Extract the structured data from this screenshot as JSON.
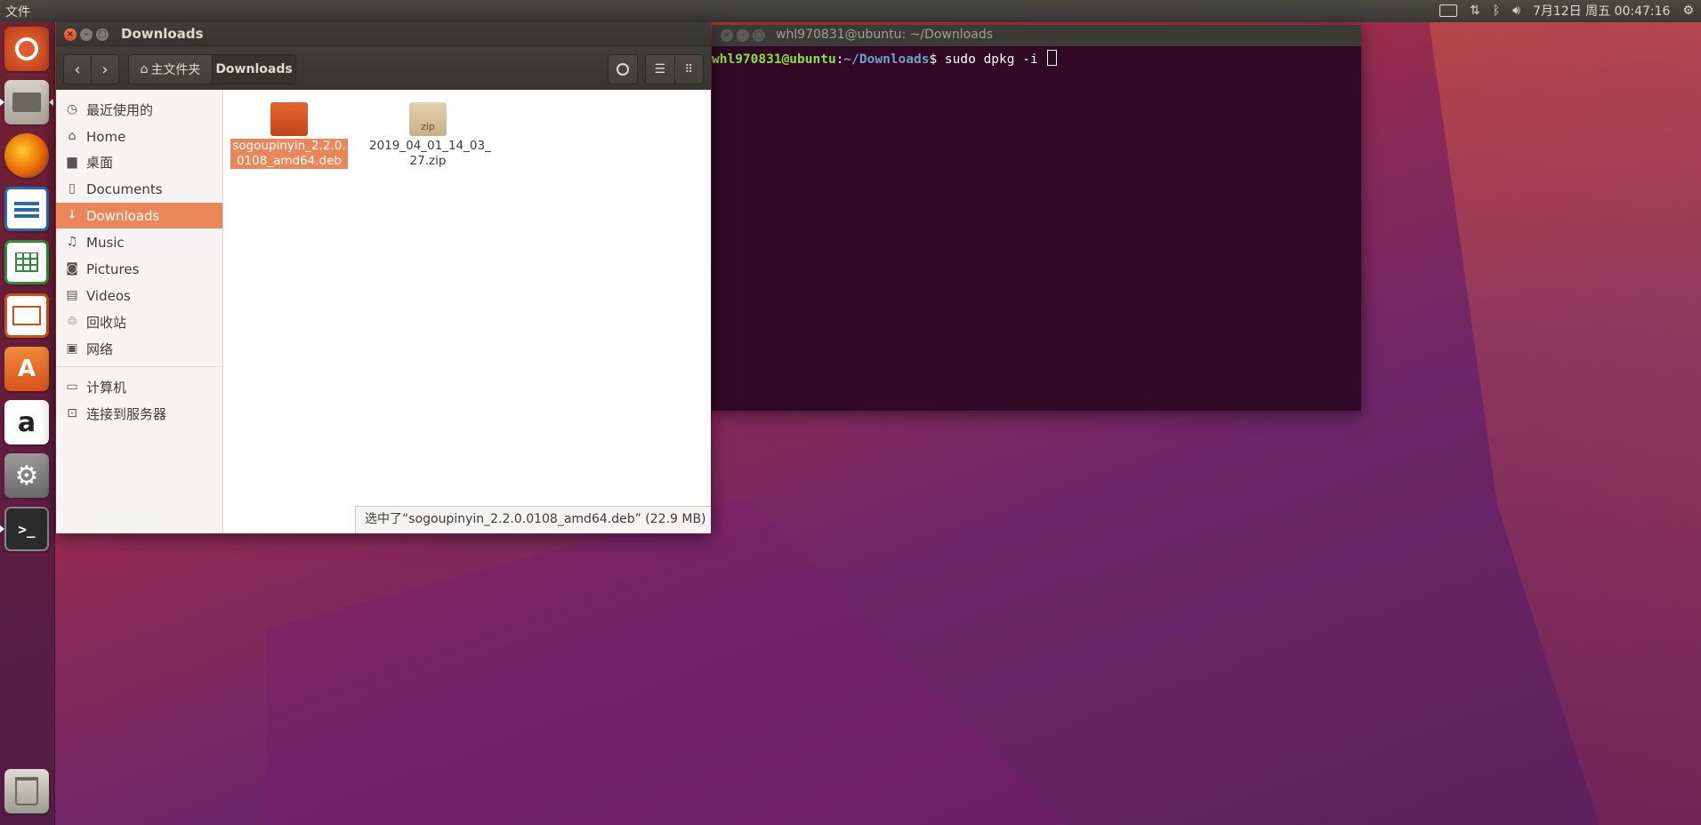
{
  "topbar": {
    "app_menu": "文件",
    "datetime": "7月12日 周五 00:47:16",
    "indicators": [
      "keyboard-icon",
      "network-icon",
      "bluetooth-icon",
      "volume-icon",
      "settings-gear-icon"
    ]
  },
  "launcher": {
    "items": [
      {
        "name": "ubuntu-dash-icon",
        "color": "#e05a2c"
      },
      {
        "name": "files-icon",
        "color": "#b9b4aa"
      },
      {
        "name": "firefox-icon",
        "color": "#e66000"
      },
      {
        "name": "writer-icon",
        "color": "#2a6aa8"
      },
      {
        "name": "calc-icon",
        "color": "#2f8b3a"
      },
      {
        "name": "impress-icon",
        "color": "#c5541d"
      },
      {
        "name": "software-center-icon",
        "color": "#e8661e"
      },
      {
        "name": "amazon-icon",
        "color": "#ffffff"
      },
      {
        "name": "system-settings-icon",
        "color": "#8c8c8c"
      },
      {
        "name": "terminal-icon",
        "color": "#2b2b2b"
      }
    ],
    "trash_icon": "trash-icon"
  },
  "file_manager": {
    "title": "Downloads",
    "breadcrumb_home": "主文件夹",
    "breadcrumb_current": "Downloads",
    "sidebar": [
      {
        "label": "最近使用的",
        "icon": "clock-icon"
      },
      {
        "label": "Home",
        "icon": "home-icon"
      },
      {
        "label": "桌面",
        "icon": "folder-icon"
      },
      {
        "label": "Documents",
        "icon": "document-icon"
      },
      {
        "label": "Downloads",
        "icon": "download-icon",
        "active": true
      },
      {
        "label": "Music",
        "icon": "music-icon"
      },
      {
        "label": "Pictures",
        "icon": "camera-icon"
      },
      {
        "label": "Videos",
        "icon": "video-icon"
      },
      {
        "label": "回收站",
        "icon": "trash-icon"
      },
      {
        "label": "网络",
        "icon": "network-icon"
      },
      {
        "label": "计算机",
        "icon": "computer-icon"
      },
      {
        "label": "连接到服务器",
        "icon": "server-icon"
      }
    ],
    "files": [
      {
        "name_line1": "sogoupinyin_2.2.0.",
        "name_line2": "0108_amd64.deb",
        "type": "deb",
        "selected": true
      },
      {
        "name_line1": "2019_04_01_14_03_",
        "name_line2": "27.zip",
        "type": "zip",
        "badge": "zip",
        "selected": false
      }
    ],
    "status": "选中了“sogoupinyin_2.2.0.0108_amd64.deb”  (22.9 MB)"
  },
  "terminal": {
    "title": "whl970831@ubuntu: ~/Downloads",
    "prompt_user": "whl970831@ubuntu",
    "prompt_sep": ":",
    "prompt_path": "~/Downloads",
    "prompt_symbol": "$",
    "command": " sudo dpkg -i "
  }
}
